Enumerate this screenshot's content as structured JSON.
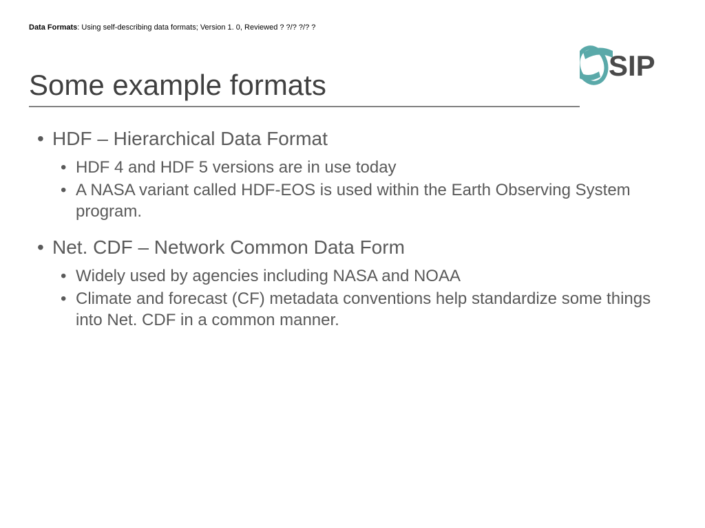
{
  "header": {
    "category": "Data Formats",
    "description": ": Using self-describing data formats; Version 1. 0, Reviewed ? ?/? ?/? ?"
  },
  "title": "Some example formats",
  "logo": {
    "text": "SIP",
    "accent_color": "#5aa9a9",
    "text_color": "#4a4a4a"
  },
  "bullets": [
    {
      "main": "HDF – Hierarchical Data Format",
      "subs": [
        "HDF 4 and HDF 5 versions are in use today",
        "A NASA variant called HDF-EOS is used within the Earth Observing System program."
      ]
    },
    {
      "main": "Net. CDF – Network Common Data Form",
      "subs": [
        "Widely used by agencies including NASA and NOAA",
        "Climate and forecast (CF) metadata conventions help standardize some things into Net. CDF in a common manner."
      ]
    }
  ]
}
